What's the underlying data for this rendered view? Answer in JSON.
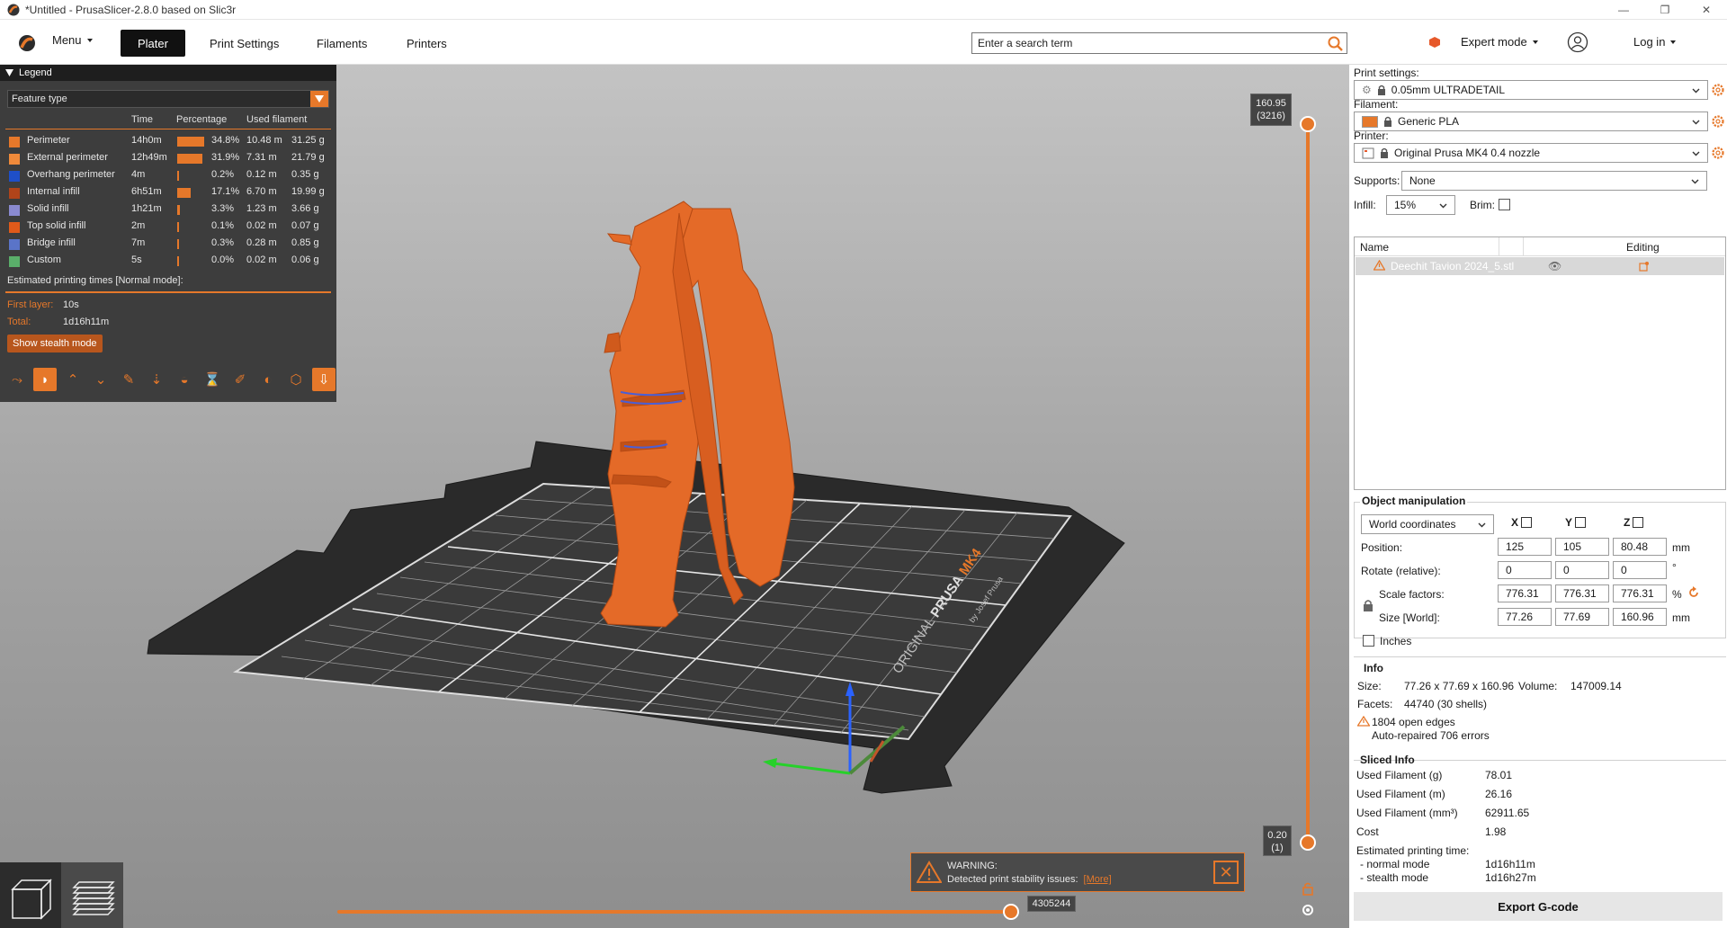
{
  "window": {
    "title": "*Untitled - PrusaSlicer-2.8.0 based on Slic3r",
    "controls": [
      "—",
      "❐",
      "✕"
    ]
  },
  "toolbar": {
    "menu": "Menu",
    "tabs": [
      "Plater",
      "Print Settings",
      "Filaments",
      "Printers"
    ],
    "search_placeholder": "Enter a search term",
    "mode": "Expert mode",
    "login": "Log in"
  },
  "legend": {
    "title": "Legend",
    "view_type": "Feature type",
    "columns": [
      "Time",
      "Percentage",
      "Used filament"
    ],
    "rows": [
      {
        "name": "Perimeter",
        "time": "14h0m",
        "pct": "34.8%",
        "pct_value": 34.8,
        "len": "10.48 m",
        "weight": "31.25 g",
        "color": "#e6782a"
      },
      {
        "name": "External perimeter",
        "time": "12h49m",
        "pct": "31.9%",
        "pct_value": 31.9,
        "len": "7.31 m",
        "weight": "21.79 g",
        "color": "#f08a3a"
      },
      {
        "name": "Overhang perimeter",
        "time": "4m",
        "pct": "0.2%",
        "pct_value": 0.2,
        "len": "0.12 m",
        "weight": "0.35 g",
        "color": "#1f4fc8"
      },
      {
        "name": "Internal infill",
        "time": "6h51m",
        "pct": "17.1%",
        "pct_value": 17.1,
        "len": "6.70 m",
        "weight": "19.99 g",
        "color": "#b0441a"
      },
      {
        "name": "Solid infill",
        "time": "1h21m",
        "pct": "3.3%",
        "pct_value": 3.3,
        "len": "1.23 m",
        "weight": "3.66 g",
        "color": "#8a8ad0"
      },
      {
        "name": "Top solid infill",
        "time": "2m",
        "pct": "0.1%",
        "pct_value": 0.1,
        "len": "0.02 m",
        "weight": "0.07 g",
        "color": "#e05a1a"
      },
      {
        "name": "Bridge infill",
        "time": "7m",
        "pct": "0.3%",
        "pct_value": 0.3,
        "len": "0.28 m",
        "weight": "0.85 g",
        "color": "#5a74c8"
      },
      {
        "name": "Custom",
        "time": "5s",
        "pct": "0.0%",
        "pct_value": 0.0,
        "len": "0.02 m",
        "weight": "0.06 g",
        "color": "#5aae6a"
      }
    ],
    "est_title": "Estimated printing times [Normal mode]:",
    "first_layer_label": "First layer:",
    "first_layer_value": "10s",
    "total_label": "Total:",
    "total_value": "1d16h11m",
    "stealth_button": "Show stealth mode"
  },
  "viewport": {
    "top_layer_height": "160.95",
    "top_layer_index": "(3216)",
    "bottom_layer_height": "0.20",
    "bottom_layer_index": "(1)",
    "move_value": "4305244",
    "bed_brand": "ORIGINAL",
    "bed_brand_bold": "PRUSA",
    "bed_model": "MK4",
    "bed_byline": "by Josef Prusa"
  },
  "warning": {
    "title": "WARNING:",
    "text": "Detected print stability issues:",
    "more": "[More]"
  },
  "rpanel": {
    "print_settings_label": "Print settings:",
    "print_settings_value": "0.05mm ULTRADETAIL",
    "filament_label": "Filament:",
    "filament_value": "Generic PLA",
    "filament_color": "#e6782a",
    "printer_label": "Printer:",
    "printer_value": "Original Prusa MK4 0.4 nozzle",
    "supports_label": "Supports:",
    "supports_value": "None",
    "infill_label": "Infill:",
    "infill_value": "15%",
    "brim_label": "Brim:",
    "list_col_name": "Name",
    "list_col_editing": "Editing",
    "object_name": "Deechit Tavion 2024_5.stl",
    "om_title": "Object manipulation",
    "coord_system": "World coordinates",
    "axis_x": "X",
    "axis_y": "Y",
    "axis_z": "Z",
    "position_label": "Position:",
    "position": [
      "125",
      "105",
      "80.48"
    ],
    "position_unit": "mm",
    "rotate_label": "Rotate (relative):",
    "rotate": [
      "0",
      "0",
      "0"
    ],
    "rotate_unit": "°",
    "scale_label": "Scale factors:",
    "scale": [
      "776.31",
      "776.31",
      "776.31"
    ],
    "scale_unit": "%",
    "size_label": "Size [World]:",
    "size": [
      "77.26",
      "77.69",
      "160.96"
    ],
    "size_unit": "mm",
    "inches_label": "Inches",
    "info_title": "Info",
    "info_size_label": "Size:",
    "info_size_value": "77.26 x 77.69 x 160.96",
    "info_volume_label": "Volume:",
    "info_volume_value": "147009.14",
    "info_facets_label": "Facets:",
    "info_facets_value": "44740 (30 shells)",
    "info_edges": "1804 open edges",
    "info_repaired": "Auto-repaired 706 errors",
    "sliced_title": "Sliced Info",
    "sliced_rows": [
      {
        "label": "Used Filament (g)",
        "value": "78.01"
      },
      {
        "label": "Used Filament (m)",
        "value": "26.16"
      },
      {
        "label": "Used Filament (mm³)",
        "value": "62911.65"
      },
      {
        "label": "Cost",
        "value": "1.98"
      }
    ],
    "est_label": "Estimated printing time:",
    "normal_label": "- normal mode",
    "normal_value": "1d16h11m",
    "stealth_label": "- stealth mode",
    "stealth_value": "1d16h27m",
    "export_button": "Export G-code"
  }
}
